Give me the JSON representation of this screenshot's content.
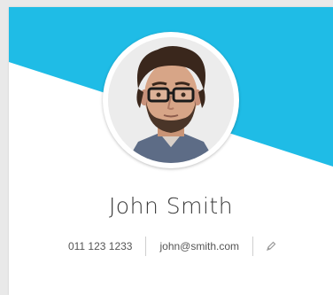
{
  "profile": {
    "name": "John Smith",
    "phone": "011 123 1233",
    "email": "john@smith.com"
  },
  "icons": {
    "avatar": "profile-photo",
    "edit": "pencil-icon"
  },
  "colors": {
    "banner": "#1fbce6",
    "card": "#ffffff",
    "background": "#e9e9e9",
    "name_text": "#3a3a3a",
    "contact_text": "#555555"
  }
}
